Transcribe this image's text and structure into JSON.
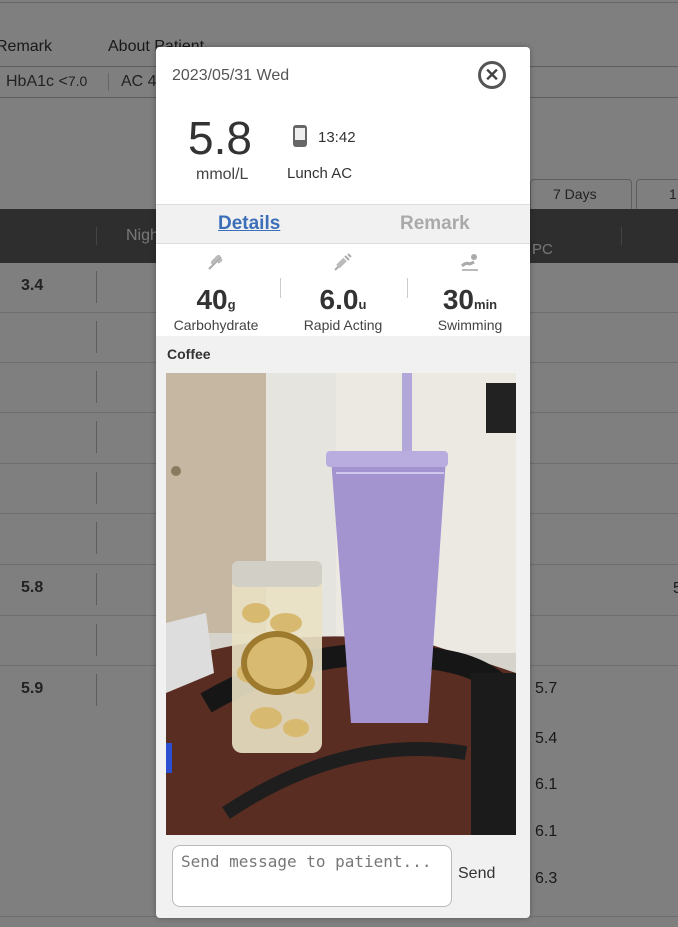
{
  "background": {
    "nav_tabs": [
      "Remark",
      "About Patient"
    ],
    "summary_bar": {
      "hba1c_label": "HbA1c <",
      "hba1c_value": "7.0",
      "ac_label": "AC 4"
    },
    "range_tabs": [
      "7 Days",
      "1"
    ],
    "table_headers": {
      "night": "Night",
      "pc": "PC"
    },
    "rows": [
      {
        "value": "3.4"
      },
      {
        "value": ""
      },
      {
        "value": ""
      },
      {
        "value": ""
      },
      {
        "value": ""
      },
      {
        "value": ""
      },
      {
        "value": "5.8"
      },
      {
        "value": ""
      },
      {
        "value": "5.9"
      }
    ],
    "pc_values": [
      "5.7",
      "5.4",
      "6.1",
      "6.1",
      "6.3"
    ],
    "right_edge_value": "5"
  },
  "modal": {
    "date": "2023/05/31 Wed",
    "glucose_value": "5.8",
    "glucose_unit": "mmol/L",
    "device_icon": "phone-icon",
    "time": "13:42",
    "meal_tag": "Lunch AC",
    "tabs": {
      "details": "Details",
      "remark": "Remark"
    },
    "stats": {
      "carb": {
        "icon": "wheat-icon",
        "value": "40",
        "unit": "g",
        "label": "Carbohydrate"
      },
      "insulin": {
        "icon": "syringe-icon",
        "value": "6.0",
        "unit": "u",
        "label": "Rapid Acting"
      },
      "exercise": {
        "icon": "swimming-icon",
        "value": "30",
        "unit": "min",
        "label": "Swimming"
      }
    },
    "food_note": "Coffee",
    "photo": "meal-photo",
    "message_placeholder": "Send message to patient...",
    "send_label": "Send"
  }
}
